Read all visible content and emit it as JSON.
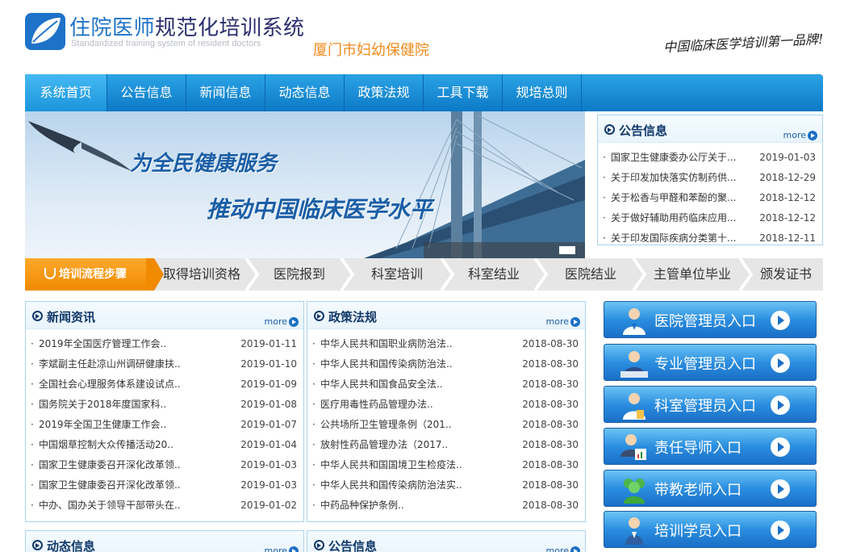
{
  "header": {
    "title_part1": "住院医师",
    "title_part2": "规范化培训系统",
    "subtitle": "Standardized training system of resident doctors",
    "hospital": "厦门市妇幼保健院",
    "slogan": "中国临床医学培训第一品牌!"
  },
  "nav": {
    "items": [
      {
        "label": "系统首页",
        "active": true
      },
      {
        "label": "公告信息"
      },
      {
        "label": "新闻信息"
      },
      {
        "label": "动态信息"
      },
      {
        "label": "政策法规"
      },
      {
        "label": "工具下载"
      },
      {
        "label": "规培总则"
      }
    ]
  },
  "banner": {
    "line1": "为全民健康服务",
    "line2": "推动中国临床医学水平"
  },
  "notice_panel": {
    "title": "公告信息",
    "more": "more",
    "items": [
      {
        "title": "国家卫生健康委办公厅关于...",
        "date": "2019-01-03"
      },
      {
        "title": "关于印发加快落实仿制药供...",
        "date": "2018-12-29"
      },
      {
        "title": "关于松香与甲醛和苯酚的聚...",
        "date": "2018-12-12"
      },
      {
        "title": "关于做好辅助用药临床应用...",
        "date": "2018-12-12"
      },
      {
        "title": "关于印发国际疾病分类第十...",
        "date": "2018-12-11"
      }
    ]
  },
  "process": {
    "first": "培训流程步骤",
    "steps": [
      "取得培训资格",
      "医院报到",
      "科室培训",
      "科室结业",
      "医院结业",
      "主管单位毕业",
      "颁发证书"
    ]
  },
  "news_panel": {
    "title": "新闻资讯",
    "more": "more",
    "items": [
      {
        "title": "2019年全国医疗管理工作会..",
        "date": "2019-01-11"
      },
      {
        "title": "李斌副主任赴凉山州调研健康扶..",
        "date": "2019-01-10"
      },
      {
        "title": "全国社会心理服务体系建设试点..",
        "date": "2019-01-09"
      },
      {
        "title": "国务院关于2018年度国家科..",
        "date": "2019-01-08"
      },
      {
        "title": "2019年全国卫生健康工作会..",
        "date": "2019-01-07"
      },
      {
        "title": "中国烟草控制大众传播活动20..",
        "date": "2019-01-04"
      },
      {
        "title": "国家卫生健康委召开深化改革领..",
        "date": "2019-01-03"
      },
      {
        "title": "国家卫生健康委召开深化改革领..",
        "date": "2019-01-03"
      },
      {
        "title": "中办、国办关于领导干部带头在..",
        "date": "2019-01-02"
      }
    ]
  },
  "policy_panel": {
    "title": "政策法规",
    "more": "more",
    "items": [
      {
        "title": "中华人民共和国职业病防治法..",
        "date": "2018-08-30"
      },
      {
        "title": "中华人民共和国传染病防治法..",
        "date": "2018-08-30"
      },
      {
        "title": "中华人民共和国食品安全法..",
        "date": "2018-08-30"
      },
      {
        "title": "医疗用毒性药品管理办法..",
        "date": "2018-08-30"
      },
      {
        "title": "公共场所卫生管理条例（201..",
        "date": "2018-08-30"
      },
      {
        "title": "放射性药品管理办法（2017..",
        "date": "2018-08-30"
      },
      {
        "title": "中华人民共和国国境卫生检疫法..",
        "date": "2018-08-30"
      },
      {
        "title": "中华人民共和国传染病防治法实..",
        "date": "2018-08-30"
      },
      {
        "title": "中药品种保护条例..",
        "date": "2018-08-30"
      }
    ]
  },
  "dynamic_panel": {
    "title": "动态信息",
    "more": "more"
  },
  "notice_panel2": {
    "title": "公告信息",
    "more": "more"
  },
  "entries": [
    {
      "label": "医院管理员入口"
    },
    {
      "label": "专业管理员入口"
    },
    {
      "label": "科室管理员入口"
    },
    {
      "label": "责任导师入口"
    },
    {
      "label": "带教老师入口"
    },
    {
      "label": "培训学员入口"
    }
  ],
  "colors": {
    "brand_blue": "#1e73c8",
    "nav_blue": "#0d79c6",
    "accent_orange": "#f08a00"
  }
}
